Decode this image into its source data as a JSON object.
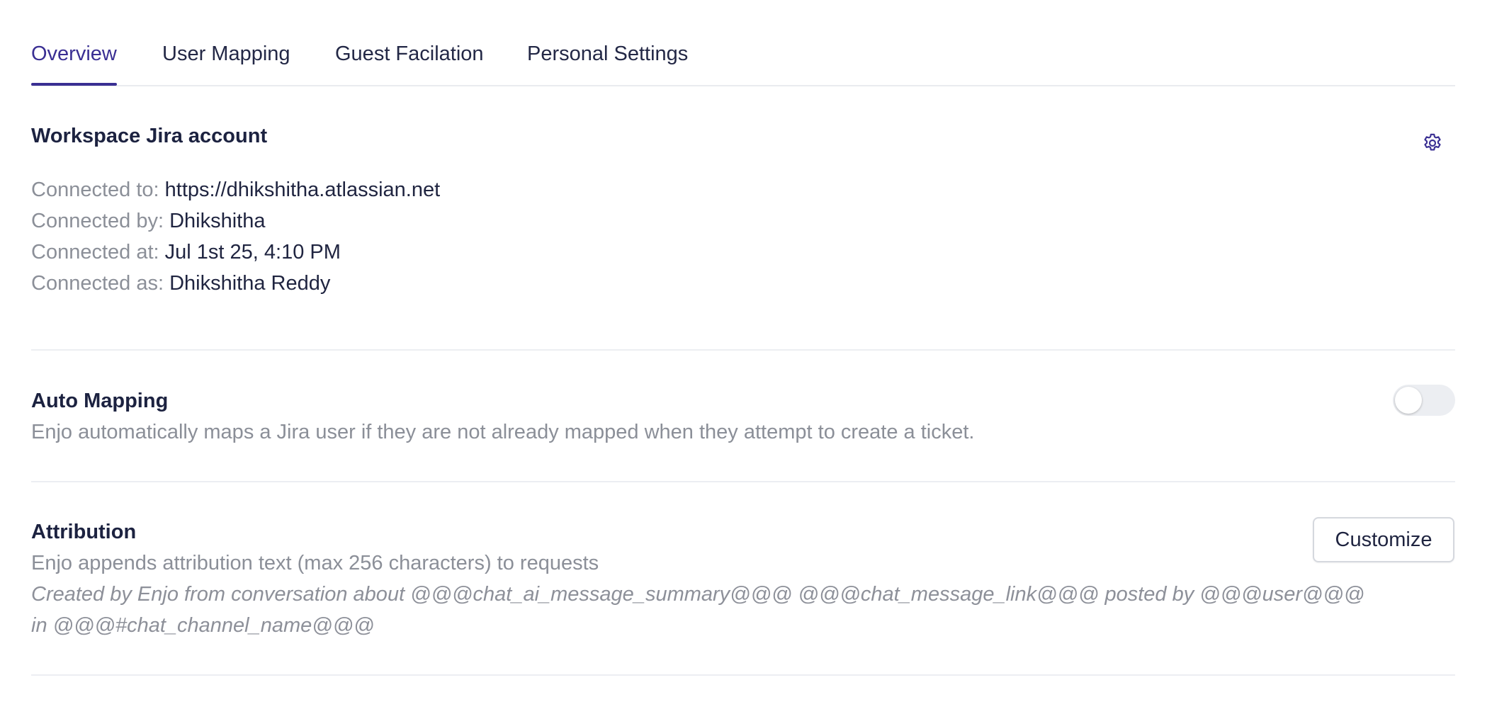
{
  "tabs": [
    {
      "label": "Overview",
      "active": true
    },
    {
      "label": "User Mapping",
      "active": false
    },
    {
      "label": "Guest Facilation",
      "active": false
    },
    {
      "label": "Personal Settings",
      "active": false
    }
  ],
  "workspace": {
    "title": "Workspace Jira account",
    "settings_icon": "gear-icon",
    "rows": [
      {
        "label": "Connected to:",
        "value": "https://dhikshitha.atlassian.net"
      },
      {
        "label": "Connected by:",
        "value": "Dhikshitha"
      },
      {
        "label": "Connected at:",
        "value": "Jul 1st 25, 4:10 PM"
      },
      {
        "label": "Connected as:",
        "value": "Dhikshitha Reddy"
      }
    ]
  },
  "auto_mapping": {
    "title": "Auto Mapping",
    "description": "Enjo automatically maps a Jira user if they are not already mapped when they attempt to create a ticket.",
    "enabled": false
  },
  "attribution": {
    "title": "Attribution",
    "description": "Enjo appends attribution text (max 256 characters) to requests",
    "template_line1": "Created by Enjo from conversation about @@@chat_ai_message_summary@@@ @@@chat_message_link@@@ posted by @@@user@@@",
    "template_line2": "in @@@#chat_channel_name@@@",
    "customize_label": "Customize"
  },
  "colors": {
    "accent": "#3a2f93",
    "text_primary": "#1f2440",
    "text_muted": "#8b8f98",
    "divider": "#eceef2"
  }
}
